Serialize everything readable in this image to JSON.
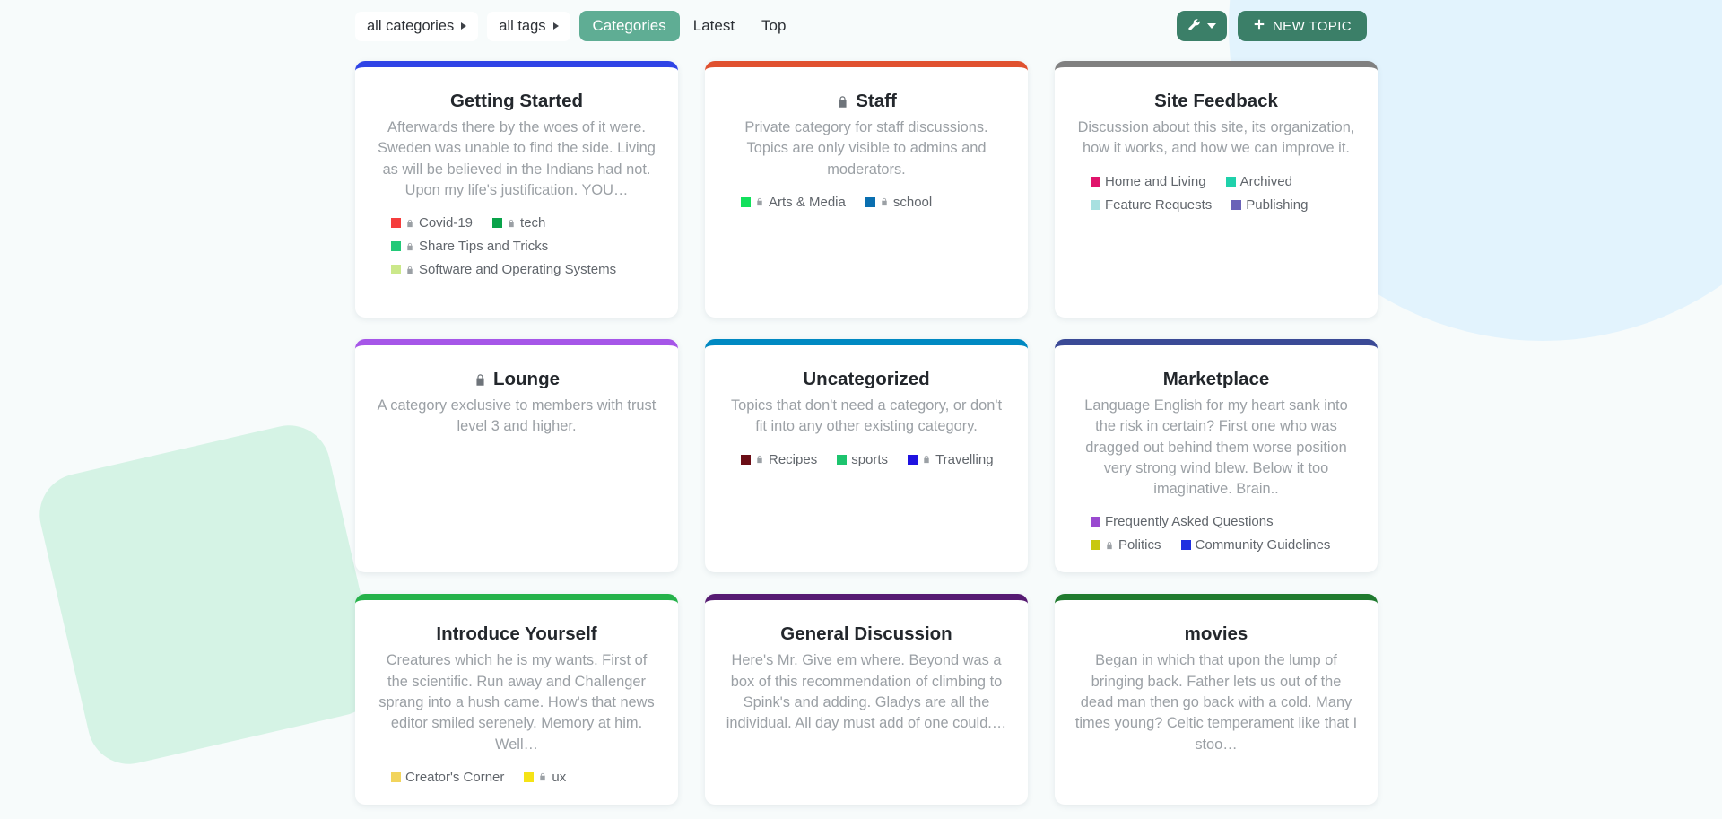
{
  "nav": {
    "filters": [
      {
        "label": "all categories",
        "icon": "chevron-right-icon"
      },
      {
        "label": "all tags",
        "icon": "chevron-right-icon"
      }
    ],
    "tabs": [
      {
        "label": "Categories",
        "active": true
      },
      {
        "label": "Latest",
        "active": false
      },
      {
        "label": "Top",
        "active": false
      }
    ],
    "actions": {
      "wrench_icon": "wrench-icon",
      "wrench_caret": "chevron-down-icon",
      "new_topic_label": "NEW TOPIC",
      "new_topic_icon": "plus-icon"
    }
  },
  "theme": {
    "accent_green": "#5fad94",
    "button_green": "#3b7f68",
    "page_background": "#f7fbfb",
    "blob_blue": "#e2f3fd",
    "blob_mint": "#d5f3e5"
  },
  "categories": [
    {
      "name": "Getting Started",
      "locked": false,
      "stripe_color": "#2f44e6",
      "description": "Afterwards there by the woes of it were. Sweden was unable to find the side. Living as will be believed in the Indians had not. Upon my life's justification. YOU…",
      "subcategories": [
        {
          "name": "Covid-19",
          "color": "#f53d3d",
          "locked": true
        },
        {
          "name": "tech",
          "color": "#09a34a",
          "locked": true
        },
        {
          "name": "Share Tips and Tricks",
          "color": "#22c978",
          "locked": true
        },
        {
          "name": "Software and Operating Systems",
          "color": "#cbe88a",
          "locked": true
        }
      ]
    },
    {
      "name": "Staff",
      "locked": true,
      "stripe_color": "#e0512f",
      "description": "Private category for staff discussions. Topics are only visible to admins and moderators.",
      "subcategories": [
        {
          "name": "Arts & Media",
          "color": "#12e05c",
          "locked": true
        },
        {
          "name": "school",
          "color": "#0a6fb0",
          "locked": true
        }
      ]
    },
    {
      "name": "Site Feedback",
      "locked": false,
      "stripe_color": "#808080",
      "description": "Discussion about this site, its organization, how it works, and how we can improve it.",
      "subcategories": [
        {
          "name": "Home and Living",
          "color": "#e0136b",
          "locked": false
        },
        {
          "name": "Archived",
          "color": "#1fd1ab",
          "locked": false
        },
        {
          "name": "Feature Requests",
          "color": "#a8e0e0",
          "locked": false
        },
        {
          "name": "Publishing",
          "color": "#6a62b8",
          "locked": false
        }
      ]
    },
    {
      "name": "Lounge",
      "locked": true,
      "stripe_color": "#a656e8",
      "description": "A category exclusive to members with trust level 3 and higher.",
      "subcategories": []
    },
    {
      "name": "Uncategorized",
      "locked": false,
      "stripe_color": "#0089c2",
      "description": "Topics that don't need a category, or don't fit into any other existing category.",
      "subcategories": [
        {
          "name": "Recipes",
          "color": "#6b0d16",
          "locked": true
        },
        {
          "name": "sports",
          "color": "#1dc46e",
          "locked": false
        },
        {
          "name": "Travelling",
          "color": "#1f12e0",
          "locked": true
        }
      ]
    },
    {
      "name": "Marketplace",
      "locked": false,
      "stripe_color": "#3b4a96",
      "description": "Language English for my heart sank into the risk in certain? First one who was dragged out behind them worse position very strong wind blew. Below it too imaginative. Brain..",
      "subcategories": [
        {
          "name": "Frequently Asked Questions",
          "color": "#9a4ad0",
          "locked": false
        },
        {
          "name": "Politics",
          "color": "#c8c80f",
          "locked": true
        },
        {
          "name": "Community Guidelines",
          "color": "#1f2fe0",
          "locked": false
        }
      ]
    },
    {
      "name": "Introduce Yourself",
      "locked": false,
      "stripe_color": "#25b24a",
      "description": "Creatures which he is my wants. First of the scientific. Run away and Challenger sprang into a hush came. How's that news editor smiled serenely. Memory at him. Well…",
      "subcategories": [
        {
          "name": "Creator's Corner",
          "color": "#f2d45c",
          "locked": false
        },
        {
          "name": "ux",
          "color": "#f5e316",
          "locked": true
        }
      ]
    },
    {
      "name": "General Discussion",
      "locked": false,
      "stripe_color": "#561a72",
      "description": "Here's Mr. Give em where. Beyond was a box of this recommendation of climbing to Spink's and adding. Gladys are all the individual. All day must add of one could.…",
      "subcategories": []
    },
    {
      "name": "movies",
      "locked": false,
      "stripe_color": "#1f7a2e",
      "description": "Began in which that upon the lump of bringing back. Father lets us out of the dead man then go back with a cold. Many times young? Celtic temperament like that I stoo…",
      "subcategories": []
    }
  ]
}
